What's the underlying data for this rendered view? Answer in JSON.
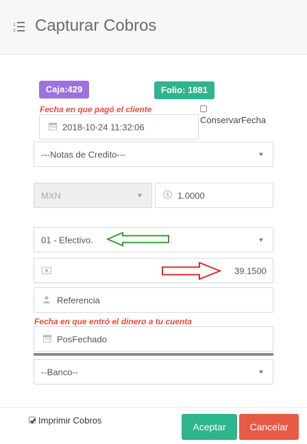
{
  "header": {
    "title": "Capturar Cobros",
    "icon": "list-ordered-icon"
  },
  "badges": {
    "caja": "Caja:429",
    "folio": "Folio: 1881",
    "caja_color": "#9a74dc",
    "folio_color": "#2db58e"
  },
  "notes": {
    "fecha_pago": "Fecha en que pagó el cliente",
    "fecha_cuenta": "Fecha en que entró el dinero a tu cuenta",
    "color": "#e74c3c"
  },
  "conservar_fecha": {
    "label": "ConservarFecha",
    "checked": false
  },
  "fields": {
    "fecha_value": "2018-10-24 11:32:06",
    "notas_credito": "---Notas de Credito---",
    "moneda": "MXN",
    "tipo_cambio": "1.0000",
    "forma_pago": "01 - Efectivo.",
    "importe": "39.1500",
    "referencia_placeholder": "Referencia",
    "posfechado_placeholder": "PosFechado",
    "banco": "--Banco--"
  },
  "footer": {
    "imprimir_label": "Imprimir Cobros",
    "imprimir_checked": true,
    "aceptar": "Aceptar",
    "cancelar": "Cancelar",
    "aceptar_color": "#2db58e",
    "cancelar_color": "#e75a45"
  },
  "annotations": {
    "green_arrow_color": "#2ca02c",
    "red_arrow_color": "#d9282f"
  }
}
